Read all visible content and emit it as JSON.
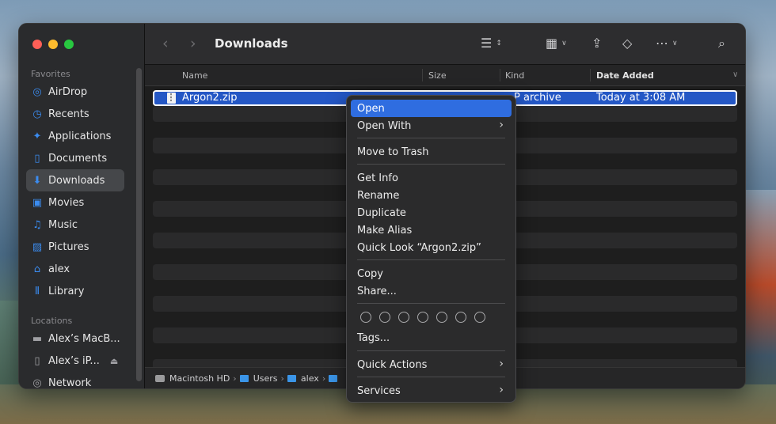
{
  "window": {
    "title": "Downloads"
  },
  "sidebar": {
    "favorites_header": "Favorites",
    "locations_header": "Locations",
    "favorites": [
      {
        "label": "AirDrop",
        "icon": "airdrop-icon"
      },
      {
        "label": "Recents",
        "icon": "clock-icon"
      },
      {
        "label": "Applications",
        "icon": "applications-icon"
      },
      {
        "label": "Documents",
        "icon": "document-icon"
      },
      {
        "label": "Downloads",
        "icon": "download-icon",
        "active": true
      },
      {
        "label": "Movies",
        "icon": "film-icon"
      },
      {
        "label": "Music",
        "icon": "music-note-icon"
      },
      {
        "label": "Pictures",
        "icon": "photo-icon"
      },
      {
        "label": "alex",
        "icon": "home-icon"
      },
      {
        "label": "Library",
        "icon": "library-icon"
      }
    ],
    "locations": [
      {
        "label": "Alex’s MacB...",
        "icon": "laptop-icon"
      },
      {
        "label": "Alex’s iP...",
        "icon": "phone-icon"
      },
      {
        "label": "Network",
        "icon": "globe-icon"
      }
    ]
  },
  "columns": {
    "name": "Name",
    "size": "Size",
    "kind": "Kind",
    "date_added": "Date Added"
  },
  "files": [
    {
      "name": "Argon2.zip",
      "kind": "P archive",
      "date_added": "Today at 3:08 AM",
      "selected": true
    }
  ],
  "pathbar": {
    "items": [
      "Macintosh HD",
      "Users",
      "alex"
    ],
    "separator": "›"
  },
  "context_menu": {
    "items": [
      "Open",
      "Open With",
      "Move to Trash",
      "Get Info",
      "Rename",
      "Duplicate",
      "Make Alias",
      "Quick Look “Argon2.zip”",
      "Copy",
      "Share...",
      "Tags...",
      "Quick Actions",
      "Services"
    ],
    "highlighted": "Open"
  },
  "colors": {
    "accent": "#2f6de0",
    "selection": "#2457c5",
    "folder": "#3b95e8"
  }
}
